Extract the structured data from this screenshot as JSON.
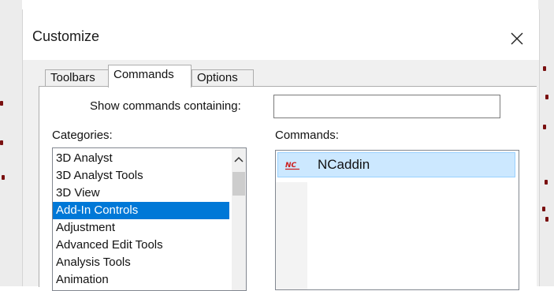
{
  "dialog": {
    "title": "Customize",
    "tabs": [
      {
        "label": "Toolbars",
        "active": false
      },
      {
        "label": "Commands",
        "active": true
      },
      {
        "label": "Options",
        "active": false
      }
    ],
    "search": {
      "label": "Show commands containing:",
      "value": ""
    },
    "categories": {
      "label": "Categories:",
      "items": [
        "3D Analyst",
        "3D Analyst Tools",
        "3D View",
        "Add-In Controls",
        "Adjustment",
        "Advanced Edit Tools",
        "Analysis Tools",
        "Animation"
      ],
      "selected": "Add-In Controls"
    },
    "commands": {
      "label": "Commands:",
      "items": [
        {
          "label": "NCaddin",
          "icon": "nc-addin-icon",
          "icon_text": "NC",
          "selected": true
        }
      ]
    }
  },
  "colors": {
    "selection": "#0078d7",
    "command_highlight": "#cce8ff",
    "icon_red": "#cc1f1f"
  }
}
